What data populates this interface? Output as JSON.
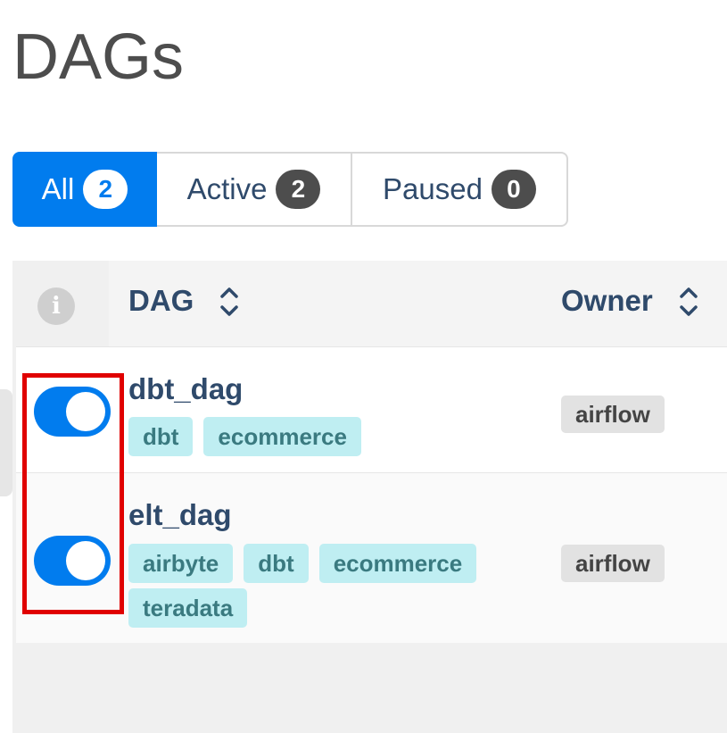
{
  "page": {
    "title": "DAGs"
  },
  "filters": [
    {
      "label": "All",
      "count": "2",
      "selected": true
    },
    {
      "label": "Active",
      "count": "2",
      "selected": false
    },
    {
      "label": "Paused",
      "count": "0",
      "selected": false
    }
  ],
  "table": {
    "columns": {
      "info_icon": "info-icon",
      "dag": "DAG",
      "owner": "Owner"
    },
    "rows": [
      {
        "dag_id": "dbt_dag",
        "active": true,
        "tags": [
          "dbt",
          "ecommerce"
        ],
        "owner": "airflow"
      },
      {
        "dag_id": "elt_dag",
        "active": true,
        "tags": [
          "airbyte",
          "dbt",
          "ecommerce",
          "teradata"
        ],
        "owner": "airflow"
      }
    ]
  },
  "colors": {
    "accent": "#017cee",
    "tag_bg": "#bfeef2",
    "highlight": "#e00000"
  }
}
